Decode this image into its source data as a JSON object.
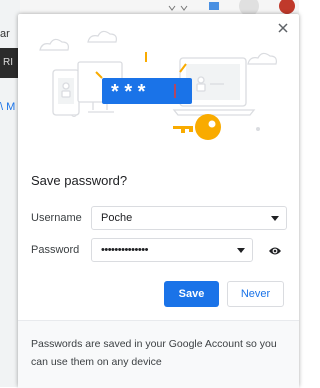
{
  "background": {
    "text_fragment_1": "ar",
    "text_fragment_2": "RI",
    "text_fragment_3": "\\ M"
  },
  "dialog": {
    "close_icon": "close-icon",
    "title": "Save password?",
    "username_label": "Username",
    "username_value": "Poche",
    "password_label": "Password",
    "password_value": "••••••••••••••",
    "password_mask_text": "* * *",
    "save_label": "Save",
    "never_label": "Never",
    "footer_text": "Passwords are saved in your Google Account so you can use them on any device",
    "colors": {
      "accent": "#1a73e8",
      "key": "#f9ab00",
      "illustration_stroke": "#dadce0"
    }
  }
}
